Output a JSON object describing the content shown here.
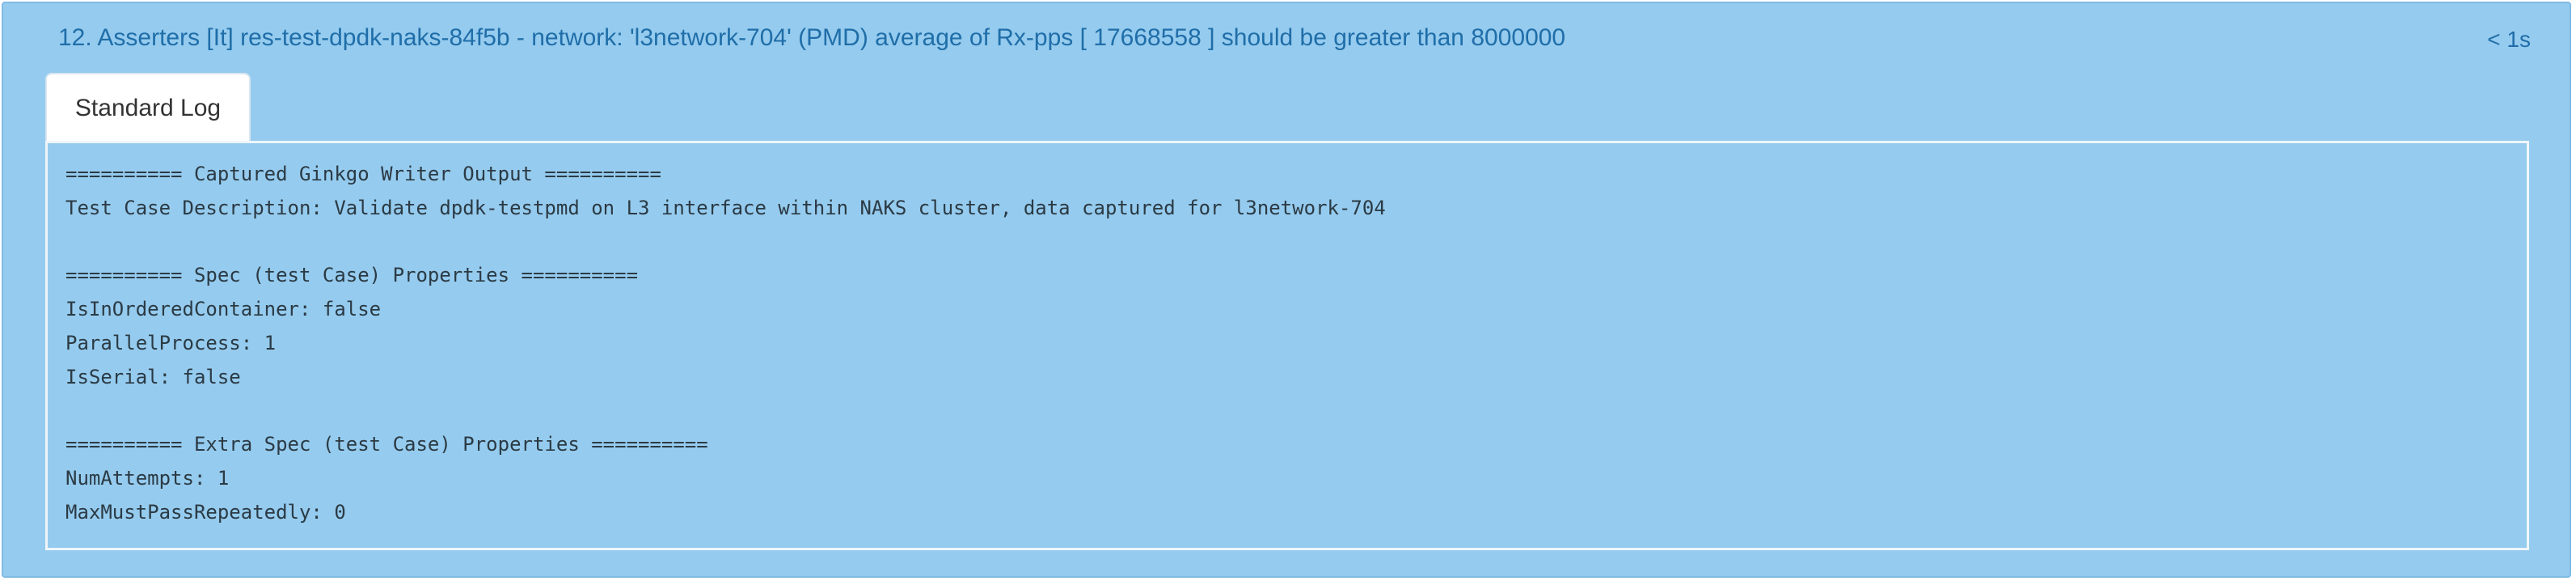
{
  "header": {
    "title": "12. Asserters [It] res-test-dpdk-naks-84f5b - network: 'l3network-704' (PMD) average of Rx-pps [ 17668558 ] should be greater than 8000000",
    "duration": "< 1s"
  },
  "tabs": [
    {
      "label": "Standard Log"
    }
  ],
  "log": {
    "lines": [
      "========== Captured Ginkgo Writer Output ==========",
      "Test Case Description: Validate dpdk-testpmd on L3 interface within NAKS cluster, data captured for l3network-704",
      "",
      "========== Spec (test Case) Properties ==========",
      "IsInOrderedContainer: false",
      "ParallelProcess: 1",
      "IsSerial: false",
      "",
      "========== Extra Spec (test Case) Properties ==========",
      "NumAttempts: 1",
      "MaxMustPassRepeatedly: 0"
    ]
  }
}
